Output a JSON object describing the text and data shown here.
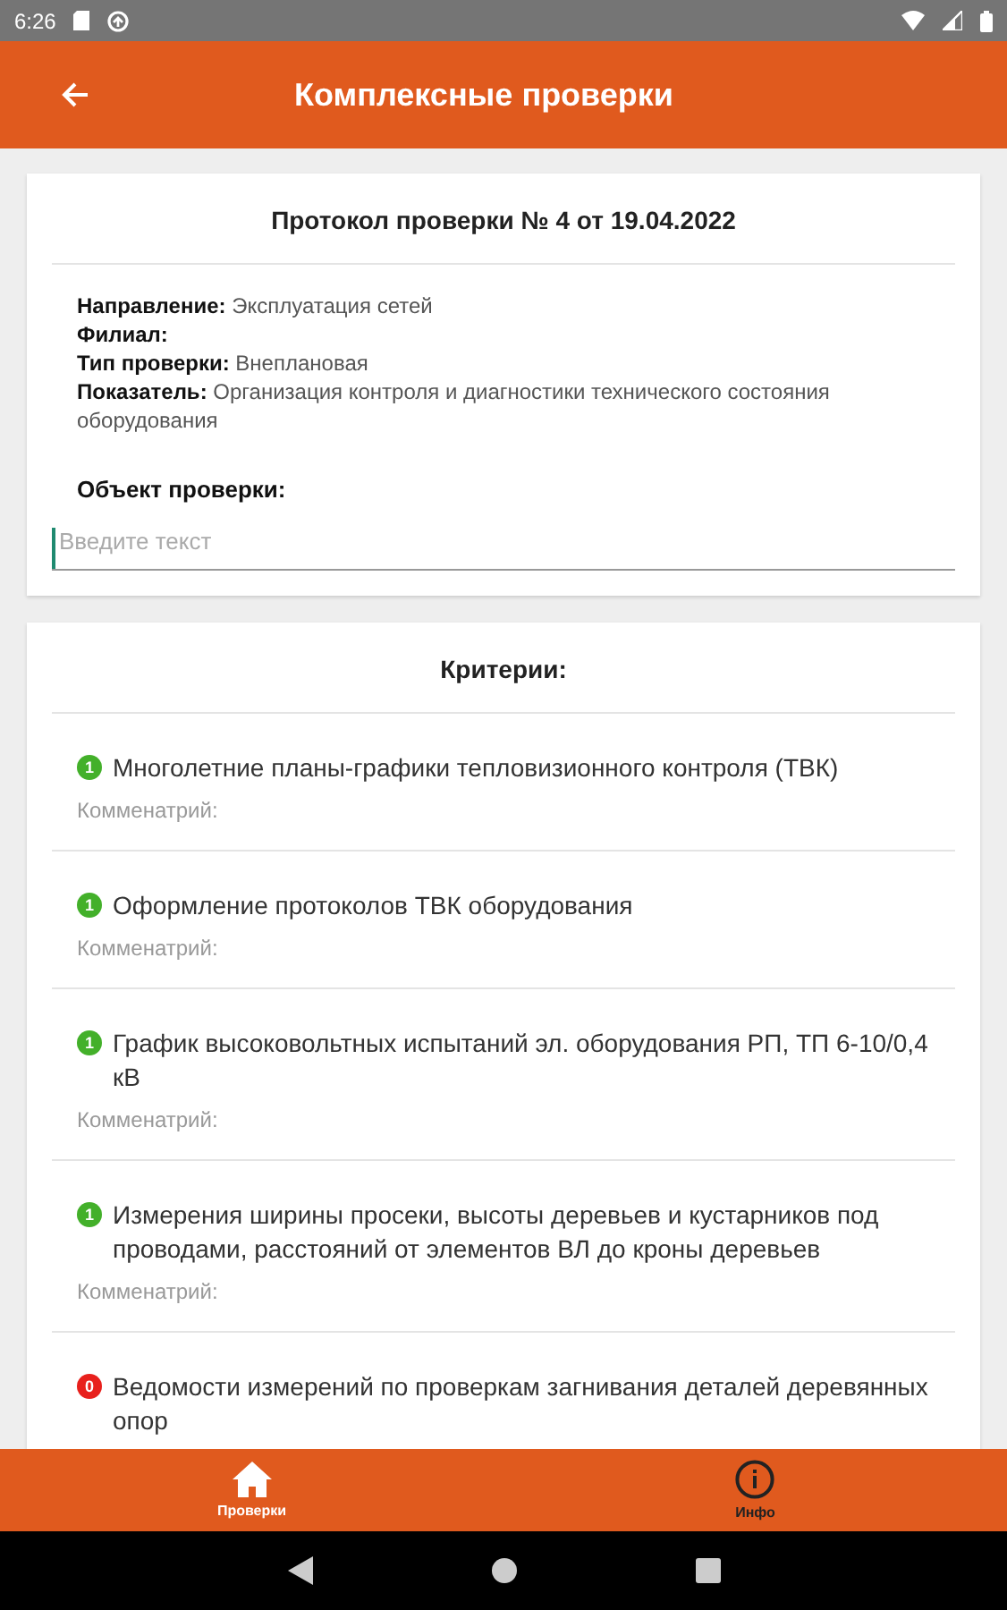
{
  "status_bar": {
    "time": "6:26"
  },
  "app_bar": {
    "title": "Комплексные проверки"
  },
  "protocol": {
    "title": "Протокол проверки № 4 от 19.04.2022",
    "fields": [
      {
        "label": "Направление:",
        "value": "Эксплуатация сетей"
      },
      {
        "label": "Филиал:"
      },
      {
        "label": "Тип проверки:",
        "value": "Внеплановая"
      },
      {
        "label": "Показатель:",
        "value": "Организация контроля и диагностики технического состояния оборудования"
      }
    ],
    "object_label": "Объект проверки:",
    "object_field": {
      "placeholder": "Введите текст"
    }
  },
  "criteria": {
    "title": "Критерии:",
    "items": [
      {
        "score": "1",
        "color": "#43b02a",
        "text": "Многолетние планы-графики тепловизионного контроля (ТВК)",
        "comment_label": "Комменатрий:"
      },
      {
        "score": "1",
        "color": "#43b02a",
        "text": "Оформление протоколов ТВК оборудования",
        "comment_label": "Комменатрий:"
      },
      {
        "score": "1",
        "color": "#43b02a",
        "text": "График высоковольтных испытаний эл. оборудования РП, ТП 6-10/0,4 кВ",
        "comment_label": "Комменатрий:"
      },
      {
        "score": "1",
        "color": "#43b02a",
        "text": "Измерения ширины просеки, высоты деревьев и кустарников под проводами, расстояний от элементов ВЛ до кроны деревьев",
        "comment_label": "Комменатрий:"
      },
      {
        "score": "0",
        "color": "#e8201c",
        "text": "Ведомости измерений по проверкам загнивания деталей деревянных опор"
      }
    ]
  },
  "bottom_nav": [
    {
      "kind": "home",
      "label": "Проверки",
      "selected": true
    },
    {
      "kind": "info",
      "label": "Инфо",
      "selected": false
    }
  ]
}
